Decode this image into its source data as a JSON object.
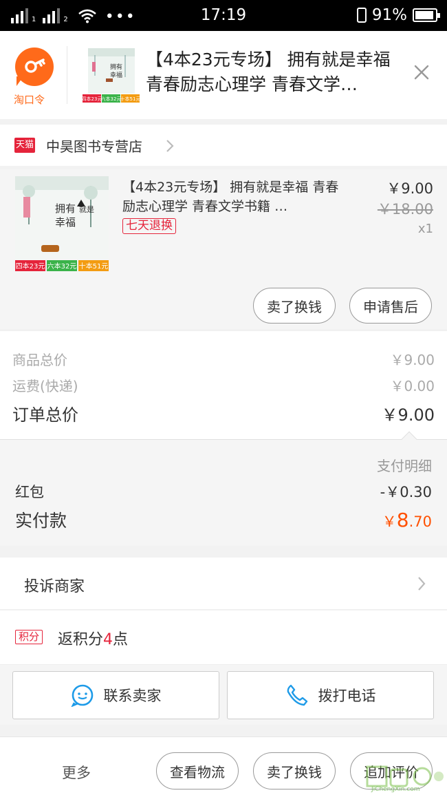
{
  "status_bar": {
    "sim1": "1",
    "sim2": "2",
    "dots": "•••",
    "time": "17:19",
    "battery": "91%"
  },
  "taokouling": {
    "logo_label": "淘口令",
    "title": "【4本23元专场】 拥有就是幸福 青春励志心理学 青春文学…",
    "thumb_tags": [
      "四本23元",
      "六本32元",
      "十本51元"
    ],
    "accent": "#ff6a1a"
  },
  "shop": {
    "badge": "天猫",
    "name": "中昊图书专营店"
  },
  "item": {
    "title": "【4本23元专场】 拥有就是幸福 青春励志心理学 青春文学书籍 …",
    "return_badge": "七天退换",
    "price": "￥9.00",
    "original_price": "￥18.00",
    "quantity": "x1",
    "cover_tags": [
      "四本23元",
      "六本32元",
      "十本51元"
    ],
    "sell_button": "卖了换钱",
    "after_sales_button": "申请售后"
  },
  "summary": {
    "goods_total_label": "商品总价",
    "goods_total_value": "￥9.00",
    "shipping_label": "运费(快递)",
    "shipping_value": "￥0.00",
    "order_total_label": "订单总价",
    "order_total_value": "￥9.00"
  },
  "pay_detail": {
    "header": "支付明细",
    "red_packet_label": "红包",
    "red_packet_value": "-￥0.30",
    "paid_label": "实付款",
    "paid_currency": "￥",
    "paid_int": "8",
    "paid_dec": ".70",
    "accent": "#ff5000"
  },
  "complain": {
    "label": "投诉商家"
  },
  "points": {
    "tag": "积分",
    "prefix": "返积分",
    "value": "4",
    "suffix": "点"
  },
  "contact": {
    "seller_button": "联系卖家",
    "call_button": "拨打电话"
  },
  "bottom_bar": {
    "more": "更多",
    "logistics_button": "查看物流",
    "sell_button": "卖了换钱",
    "review_button": "追加评价"
  },
  "watermark_text": "JiChengXin.com"
}
